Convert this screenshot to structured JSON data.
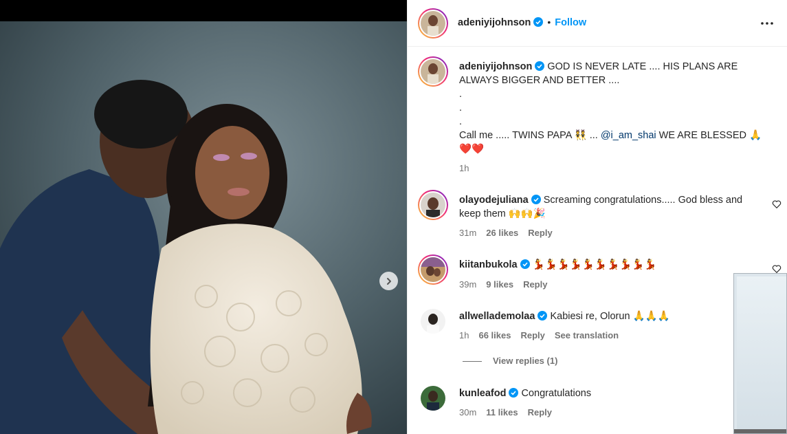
{
  "post": {
    "author": "adeniyijohnson",
    "follow_label": "Follow",
    "separator": "•",
    "caption_lines": [
      "GOD IS NEVER LATE .... HIS PLANS ARE",
      "ALWAYS BIGGER AND BETTER ....",
      ".",
      ".",
      "."
    ],
    "caption_call": "Call me ..... TWINS PAPA",
    "caption_twins_emoji": "👯",
    "caption_mid": "...",
    "caption_mention": "@i_am_shai",
    "caption_blessed": "WE ARE BLESSED",
    "caption_pray_emoji": "🙏",
    "caption_hearts": "❤️❤️",
    "time": "1h"
  },
  "comments": [
    {
      "username": "olayodejuliana",
      "text_line1": "Screaming congratulations..... God bless and",
      "text_line2": "keep them",
      "emojis": "🙌🙌🎉",
      "time": "31m",
      "likes": "26 likes",
      "reply": "Reply"
    },
    {
      "username": "kiitanbukola",
      "text_line1": "",
      "emojis": "💃💃💃💃💃💃💃💃💃💃",
      "time": "39m",
      "likes": "9 likes",
      "reply": "Reply"
    },
    {
      "username": "allwellademolaa",
      "text_line1": "Kabiesi re, Olorun",
      "emojis": "🙏🙏🙏",
      "time": "1h",
      "likes": "66 likes",
      "reply": "Reply",
      "see_translation": "See translation",
      "view_replies": "View replies (1)"
    },
    {
      "username": "kunleafod",
      "text_line1": "Congratulations",
      "time": "30m",
      "likes": "11 likes",
      "reply": "Reply"
    }
  ],
  "icons": {
    "verified": "verified-badge-icon",
    "more": "more-options-icon",
    "like": "heart-outline-icon",
    "next": "chevron-right-icon"
  },
  "colors": {
    "accent": "#0095f6",
    "verified": "#0095f6",
    "muted": "#737373",
    "mention": "#00376b"
  }
}
